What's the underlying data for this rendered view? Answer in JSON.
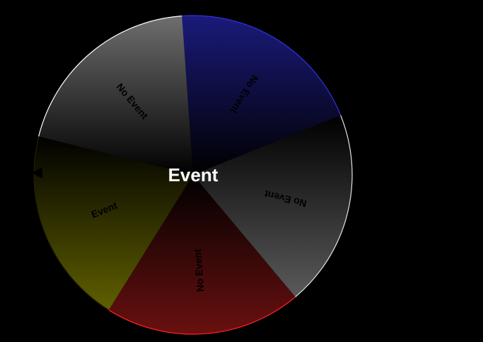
{
  "wheel": {
    "result_label": "Event",
    "segments": [
      {
        "label": "No Event",
        "color": "#1a1a7a",
        "rim": "#3030e0",
        "id": "blue"
      },
      {
        "label": "No Event",
        "color": "#5a5a5a",
        "rim": "#e0e0e0",
        "id": "gray-right"
      },
      {
        "label": "No Event",
        "color": "#6a1010",
        "rim": "#ff2020",
        "id": "red"
      },
      {
        "label": "Event",
        "color": "#606000",
        "rim": "#202000",
        "id": "olive"
      },
      {
        "label": "No Event",
        "color": "#6e6e6e",
        "rim": "#ffffff",
        "id": "gray-left"
      }
    ],
    "pointer_icon": "triangle-pointer-icon"
  }
}
